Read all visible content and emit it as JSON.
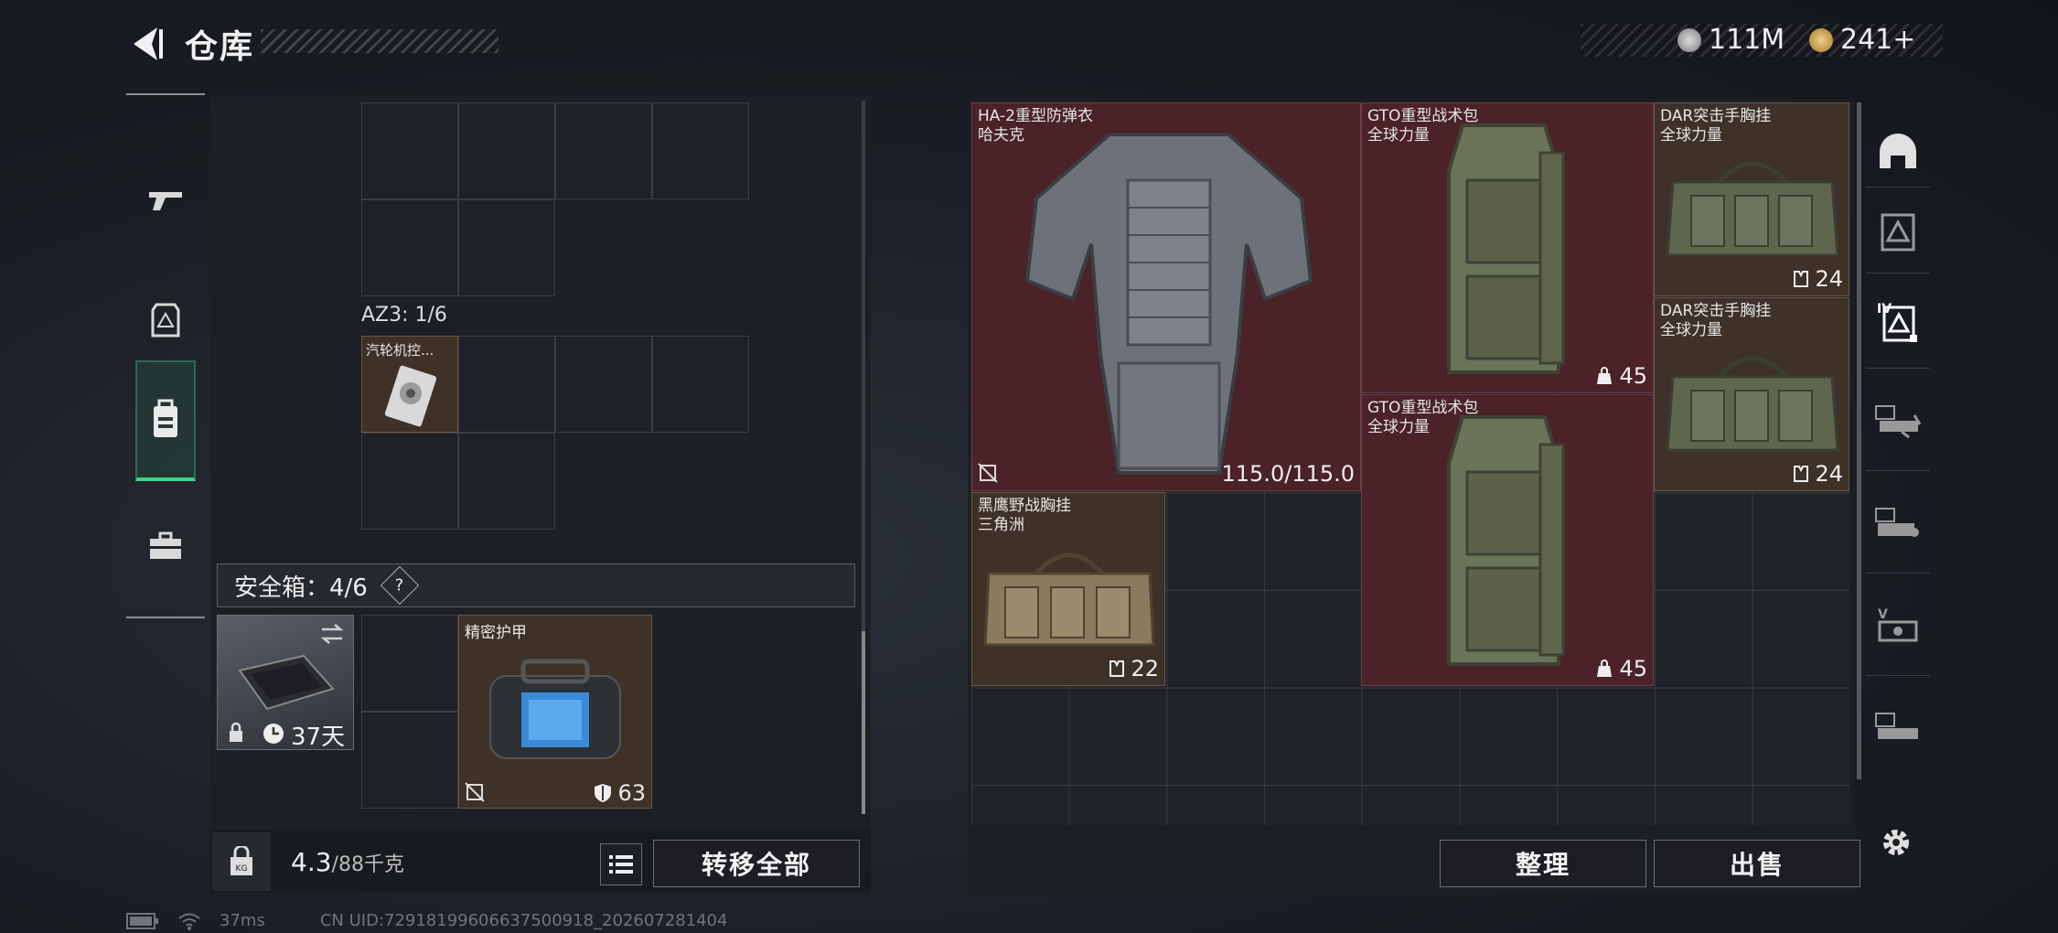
{
  "header": {
    "title": "仓库",
    "currency_1": "111M",
    "currency_2": "241+"
  },
  "left_tabs": [
    {
      "name": "weapon-tab"
    },
    {
      "name": "armor-tab"
    },
    {
      "name": "backpack-tab",
      "active": true
    },
    {
      "name": "case-tab"
    }
  ],
  "left_panel": {
    "az3_label": "AZ3: 1/6",
    "az3_item_name": "汽轮机控...",
    "safe_box_label": "安全箱：4/6",
    "safe_box_help": "?",
    "safe_box_days": "37天",
    "safe_item_name": "精密护甲",
    "safe_item_value": "63",
    "weight_value": "4.3",
    "weight_unit": "/88千克",
    "transfer_all_label": "转移全部"
  },
  "right_panel": {
    "items": [
      {
        "name": "HA-2重型防弹衣",
        "sub": "哈夫克",
        "value": "115.0/115.0"
      },
      {
        "name": "GTO重型战术包",
        "sub": "全球力量",
        "value": "45"
      },
      {
        "name": "DAR突击手胸挂",
        "sub": "全球力量",
        "value": "24"
      },
      {
        "name": "DAR突击手胸挂",
        "sub": "全球力量",
        "value": "24"
      },
      {
        "name": "GTO重型战术包",
        "sub": "全球力量",
        "value": "45"
      },
      {
        "name": "黑鹰野战胸挂",
        "sub": "三角洲",
        "value": "22"
      }
    ],
    "sort_label": "整理",
    "sell_label": "出售"
  },
  "footer": {
    "ping": "37ms",
    "uid": "CN UID:72918199606637500918_202607281404"
  }
}
